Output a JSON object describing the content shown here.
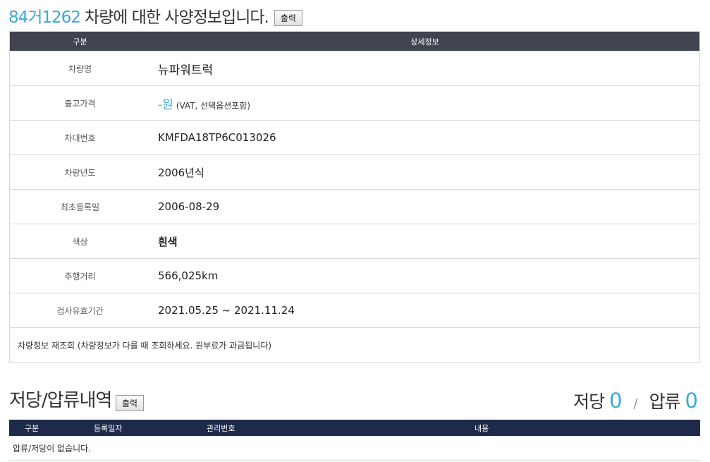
{
  "header": {
    "plate": "84거1262",
    "title_suffix": "차량에 대한 사양정보입니다.",
    "print_label": "출력"
  },
  "spec_table": {
    "columns": [
      "구분",
      "상세정보"
    ],
    "rows": {
      "name": {
        "label": "차량명",
        "value": "뉴파워트럭"
      },
      "price": {
        "label": "출고가격",
        "value": "-원",
        "note": "(VAT, 선택옵션포함)"
      },
      "vin": {
        "label": "차대번호",
        "value": "KMFDA18TP6C013026"
      },
      "year": {
        "label": "차량년도",
        "value": "2006년식"
      },
      "reg": {
        "label": "최초등록일",
        "value": "2006-08-29"
      },
      "color": {
        "label": "색상",
        "value": "흰색"
      },
      "mileage": {
        "label": "주행거리",
        "value": "566,025km"
      },
      "inspect": {
        "label": "검사유효기간",
        "value": "2021.05.25 ~ 2021.11.24"
      }
    },
    "notice": "차량정보 재조회 (차량정보가 다를 때 조회하세요. 원부료가 과금됩니다)"
  },
  "lien": {
    "title": "저당/압류내역",
    "print_label": "출력",
    "mortgage_label": "저당",
    "mortgage_count": "0",
    "slash": "/",
    "seizure_label": "압류",
    "seizure_count": "0",
    "columns": {
      "type": "구분",
      "date": "등록일자",
      "id": "관리번호",
      "content": "내용"
    },
    "empty_message": "압류/저당이 없습니다."
  },
  "colors": {
    "accent": "#3aa8d8",
    "header_dark": "#3f4450",
    "header_navy": "#1e2a4a"
  }
}
